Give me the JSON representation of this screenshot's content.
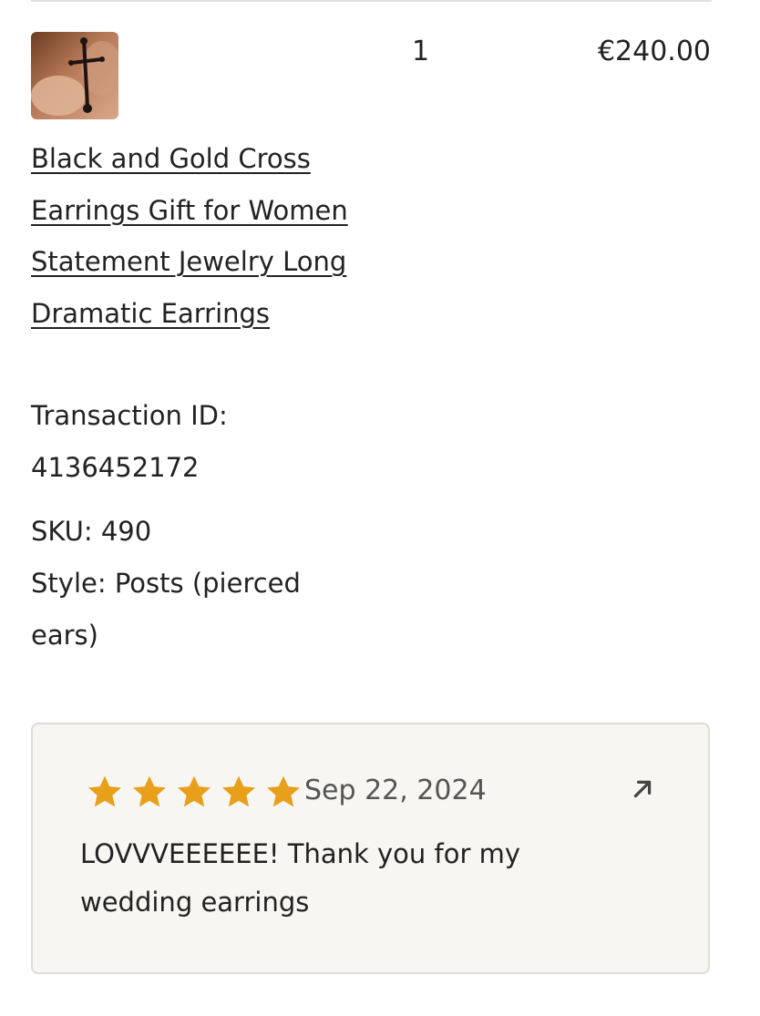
{
  "order_item": {
    "thumbnail": "product-thumbnail",
    "quantity": "1",
    "price": "€240.00",
    "title": "Black and Gold Cross Earrings Gift for Women Statement Jewelry Long Dramatic Earrings",
    "transaction_label": "Transaction ID:",
    "transaction_id": "4136452172",
    "sku": "SKU: 490",
    "style": "Style: Posts (pierced ears)"
  },
  "review": {
    "rating": 5,
    "rating_max": 5,
    "star_color": "#e8a01b",
    "date": "Sep 22, 2024",
    "text": "LOVVVEEEEEE! Thank you for my wedding earrings",
    "open_icon": "arrow-up-right-icon"
  }
}
